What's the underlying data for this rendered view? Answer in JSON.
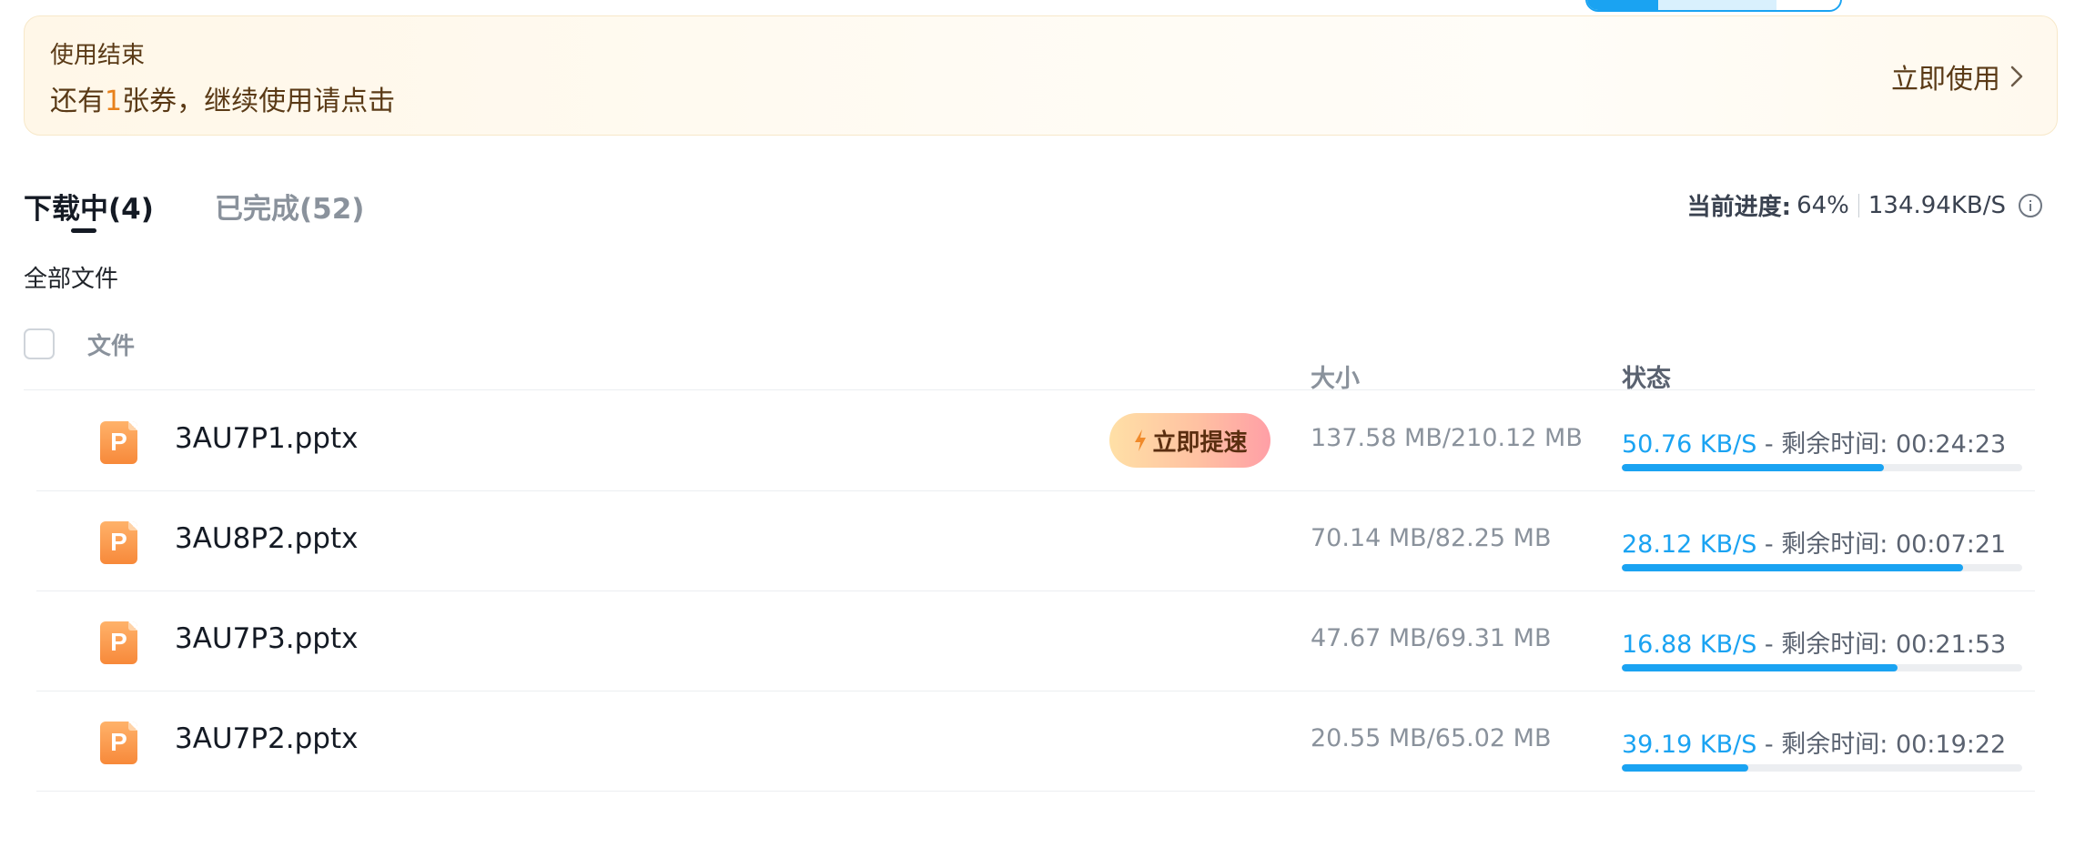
{
  "banner": {
    "title": "使用结束",
    "desc_pre": "还有",
    "desc_count": "1",
    "desc_post": "张券，继续使用请点击",
    "action": "立即使用"
  },
  "tabs": [
    {
      "label": "下载中(4)",
      "active": true
    },
    {
      "label": "已完成(52)",
      "active": false
    }
  ],
  "summary": {
    "label": "当前进度:",
    "percent": "64%",
    "speed": "134.94KB/S"
  },
  "breadcrumb": "全部文件",
  "columns": {
    "file": "文件",
    "size": "大小",
    "status": "状态"
  },
  "remaining_label": " - 剩余时间: ",
  "boost_label": "立即提速",
  "file_icon_letter": "P",
  "rows": [
    {
      "name": "3AU7P1.pptx",
      "size": "137.58 MB/210.12 MB",
      "speed": "50.76 KB/S",
      "remaining": "00:24:23",
      "progress": 0.655,
      "boost": true
    },
    {
      "name": "3AU8P2.pptx",
      "size": "70.14 MB/82.25 MB",
      "speed": "28.12 KB/S",
      "remaining": "00:07:21",
      "progress": 0.853,
      "boost": false
    },
    {
      "name": "3AU7P3.pptx",
      "size": "47.67 MB/69.31 MB",
      "speed": "16.88 KB/S",
      "remaining": "00:21:53",
      "progress": 0.688,
      "boost": false
    },
    {
      "name": "3AU7P2.pptx",
      "size": "20.55 MB/65.02 MB",
      "speed": "39.19 KB/S",
      "remaining": "00:19:22",
      "progress": 0.316,
      "boost": false
    }
  ],
  "colors": {
    "accent": "#1aa3f2",
    "banner_text": "#5a3a16",
    "highlight": "#e8811b"
  },
  "icons": {
    "banner_action": "chevron-right-icon",
    "boost": "lightning-icon",
    "summary": "info-icon",
    "file": "pptx-file-icon"
  }
}
